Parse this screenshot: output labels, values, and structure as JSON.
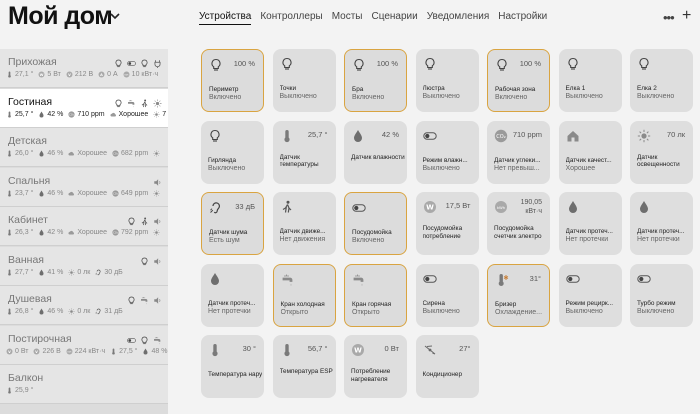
{
  "header": {
    "home_title": "Мой дом",
    "tabs": [
      {
        "label": "Устройства",
        "active": true
      },
      {
        "label": "Контроллеры",
        "active": false
      },
      {
        "label": "Мосты",
        "active": false
      },
      {
        "label": "Сценарии",
        "active": false
      },
      {
        "label": "Уведомления",
        "active": false
      },
      {
        "label": "Настройки",
        "active": false
      }
    ],
    "more_label": "•••",
    "add_label": "+"
  },
  "rooms": [
    {
      "name": "Прихожая",
      "active": false,
      "icons": [
        "bulb-icon",
        "toggle-icon",
        "bulb-icon",
        "plug-icon"
      ],
      "stats": [
        {
          "icon": "thermometer-icon",
          "text": "27,1 °"
        },
        {
          "icon": "power-icon",
          "text": "5 Вт"
        },
        {
          "icon": "voltage-icon",
          "text": "212 В"
        },
        {
          "icon": "current-icon",
          "text": "0 А"
        },
        {
          "icon": "energy-icon",
          "text": "10 кВт·ч"
        }
      ]
    },
    {
      "name": "Гостиная",
      "active": true,
      "icons": [
        "bulb-icon",
        "tap-icon",
        "person-icon",
        "sun-icon"
      ],
      "stats": [
        {
          "icon": "thermometer-icon",
          "text": "25,7 °"
        },
        {
          "icon": "drop-icon",
          "text": "42 %"
        },
        {
          "icon": "co2-icon",
          "text": "710 ppm"
        },
        {
          "icon": "cloud-icon",
          "text": "Хорошее"
        },
        {
          "icon": "sun-icon",
          "text": "7"
        }
      ]
    },
    {
      "name": "Детская",
      "active": false,
      "icons": [],
      "stats": [
        {
          "icon": "thermometer-icon",
          "text": "26,0 °"
        },
        {
          "icon": "drop-icon",
          "text": "46 %"
        },
        {
          "icon": "cloud-icon",
          "text": "Хорошее"
        },
        {
          "icon": "co2-icon",
          "text": "682 ppm"
        },
        {
          "icon": "sun-icon",
          "text": ""
        }
      ]
    },
    {
      "name": "Спальня",
      "active": false,
      "icons": [
        "speaker-icon"
      ],
      "stats": [
        {
          "icon": "thermometer-icon",
          "text": "23,7 °"
        },
        {
          "icon": "drop-icon",
          "text": "46 %"
        },
        {
          "icon": "cloud-icon",
          "text": "Хорошее"
        },
        {
          "icon": "co2-icon",
          "text": "649 ppm"
        },
        {
          "icon": "sun-icon",
          "text": ""
        }
      ]
    },
    {
      "name": "Кабинет",
      "active": false,
      "icons": [
        "bulb-icon",
        "person-icon",
        "speaker-icon"
      ],
      "stats": [
        {
          "icon": "thermometer-icon",
          "text": "26,3 °"
        },
        {
          "icon": "drop-icon",
          "text": "42 %"
        },
        {
          "icon": "cloud-icon",
          "text": "Хорошее"
        },
        {
          "icon": "co2-icon",
          "text": "792 ppm"
        },
        {
          "icon": "sun-icon",
          "text": ""
        }
      ]
    },
    {
      "name": "Ванная",
      "active": false,
      "icons": [
        "bulb-icon",
        "speaker-icon"
      ],
      "stats": [
        {
          "icon": "thermometer-icon",
          "text": "27,7 °"
        },
        {
          "icon": "drop-icon",
          "text": "41 %"
        },
        {
          "icon": "sun-icon",
          "text": "0 лк"
        },
        {
          "icon": "ear-icon",
          "text": "30 дБ"
        }
      ]
    },
    {
      "name": "Душевая",
      "active": false,
      "icons": [
        "bulb-icon",
        "tap-icon",
        "speaker-icon"
      ],
      "stats": [
        {
          "icon": "thermometer-icon",
          "text": "26,8 °"
        },
        {
          "icon": "drop-icon",
          "text": "46 %"
        },
        {
          "icon": "sun-icon",
          "text": "0 лк"
        },
        {
          "icon": "ear-icon",
          "text": "31 дБ"
        }
      ]
    },
    {
      "name": "Постирочная",
      "active": false,
      "icons": [
        "toggle-icon",
        "bulb-icon",
        "tap-icon"
      ],
      "stats": [
        {
          "icon": "voltage-icon",
          "text": "0 Вт"
        },
        {
          "icon": "voltage-icon",
          "text": "226 В"
        },
        {
          "icon": "energy-icon",
          "text": "224 кВт·ч"
        },
        {
          "icon": "thermometer-icon",
          "text": "27,5 °"
        },
        {
          "icon": "drop-icon",
          "text": "48 %"
        }
      ]
    },
    {
      "name": "Балкон",
      "active": false,
      "icons": [],
      "stats": [
        {
          "icon": "thermometer-icon",
          "text": "25,9 °"
        }
      ]
    }
  ],
  "devices": [
    {
      "name": "Периметр",
      "status": "Включено",
      "value": "100 %",
      "icon": "bulb-icon",
      "on": true
    },
    {
      "name": "Точки",
      "status": "Выключено",
      "value": "",
      "icon": "bulb-icon",
      "on": false
    },
    {
      "name": "Бра",
      "status": "Включено",
      "value": "100 %",
      "icon": "bulb-icon",
      "on": true
    },
    {
      "name": "Люстра",
      "status": "Выключено",
      "value": "",
      "icon": "bulb-icon",
      "on": false
    },
    {
      "name": "Рабочая зона",
      "status": "Включено",
      "value": "100 %",
      "icon": "bulb-icon",
      "on": true
    },
    {
      "name": "Елка 1",
      "status": "Выключено",
      "value": "",
      "icon": "bulb-icon",
      "on": false
    },
    {
      "name": "Елка 2",
      "status": "Выключено",
      "value": "",
      "icon": "bulb-icon",
      "on": false
    },
    {
      "name": "Гирлянда",
      "status": "Выключено",
      "value": "",
      "icon": "bulb-icon",
      "on": false
    },
    {
      "name": "Датчик температуры",
      "status": "",
      "value": "25,7 °",
      "icon": "thermometer-icon",
      "on": false
    },
    {
      "name": "Датчик влажности",
      "status": "",
      "value": "42 %",
      "icon": "drop-icon",
      "on": false
    },
    {
      "name": "Режим влажн...",
      "status": "Выключено",
      "value": "",
      "icon": "toggle-icon",
      "on": false
    },
    {
      "name": "Датчик углеки...",
      "status": "Нет превыш...",
      "value": "710 ppm",
      "icon": "co2-icon",
      "on": false
    },
    {
      "name": "Датчик качест...",
      "status": "Хорошее",
      "value": "",
      "icon": "house-icon",
      "on": false
    },
    {
      "name": "Датчик освещенности",
      "status": "",
      "value": "70 лк",
      "icon": "sun-icon",
      "on": false
    },
    {
      "name": "Датчик шума",
      "status": "Есть шум",
      "value": "33 дБ",
      "icon": "ear-icon",
      "on": true
    },
    {
      "name": "Датчик движе...",
      "status": "Нет движения",
      "value": "",
      "icon": "person-icon",
      "on": false
    },
    {
      "name": "Посудомойка",
      "status": "Включено",
      "value": "",
      "icon": "toggle-icon",
      "on": true
    },
    {
      "name": "Посудомойка потребление",
      "status": "",
      "value": "17,5 Вт",
      "icon": "power-icon",
      "on": false
    },
    {
      "name": "Посудомойка счетчик электро",
      "status": "",
      "value": "190,05 кВт·ч",
      "icon": "energy-icon",
      "on": false
    },
    {
      "name": "Датчик протеч...",
      "status": "Нет протечки",
      "value": "",
      "icon": "drop-icon",
      "on": false
    },
    {
      "name": "Датчик протеч...",
      "status": "Нет протечки",
      "value": "",
      "icon": "drop-icon",
      "on": false
    },
    {
      "name": "Датчик протеч...",
      "status": "Нет протечки",
      "value": "",
      "icon": "drop-icon",
      "on": false
    },
    {
      "name": "Кран холодная",
      "status": "Открыто",
      "value": "",
      "icon": "tap-icon",
      "on": true
    },
    {
      "name": "Кран горячая",
      "status": "Открыто",
      "value": "",
      "icon": "tap-icon",
      "on": true
    },
    {
      "name": "Сирена",
      "status": "Выключено",
      "value": "",
      "icon": "toggle-icon",
      "on": false
    },
    {
      "name": "Бризер",
      "status": "Охлаждение...",
      "value": "31°",
      "icon": "breezer-icon",
      "on": true
    },
    {
      "name": "Режим рецирк...",
      "status": "Выключено",
      "value": "",
      "icon": "toggle-icon",
      "on": false
    },
    {
      "name": "Турбо режим",
      "status": "Выключено",
      "value": "",
      "icon": "toggle-icon",
      "on": false
    },
    {
      "name": "Температура наружного...",
      "status": "",
      "value": "30 °",
      "icon": "thermometer-icon",
      "on": false
    },
    {
      "name": "Температура ESP",
      "status": "",
      "value": "56,7 °",
      "icon": "thermometer-icon",
      "on": false
    },
    {
      "name": "Потребление нагревателя",
      "status": "",
      "value": "0 Вт",
      "icon": "power-icon",
      "on": false
    },
    {
      "name": "Кондиционер",
      "status": "",
      "value": "27°",
      "icon": "ac-icon",
      "on": false
    }
  ],
  "colors": {
    "accent": "#d9a441",
    "tile": "#dedede",
    "sidebar": "#e5e5e5",
    "active_room": "#ffffff"
  }
}
